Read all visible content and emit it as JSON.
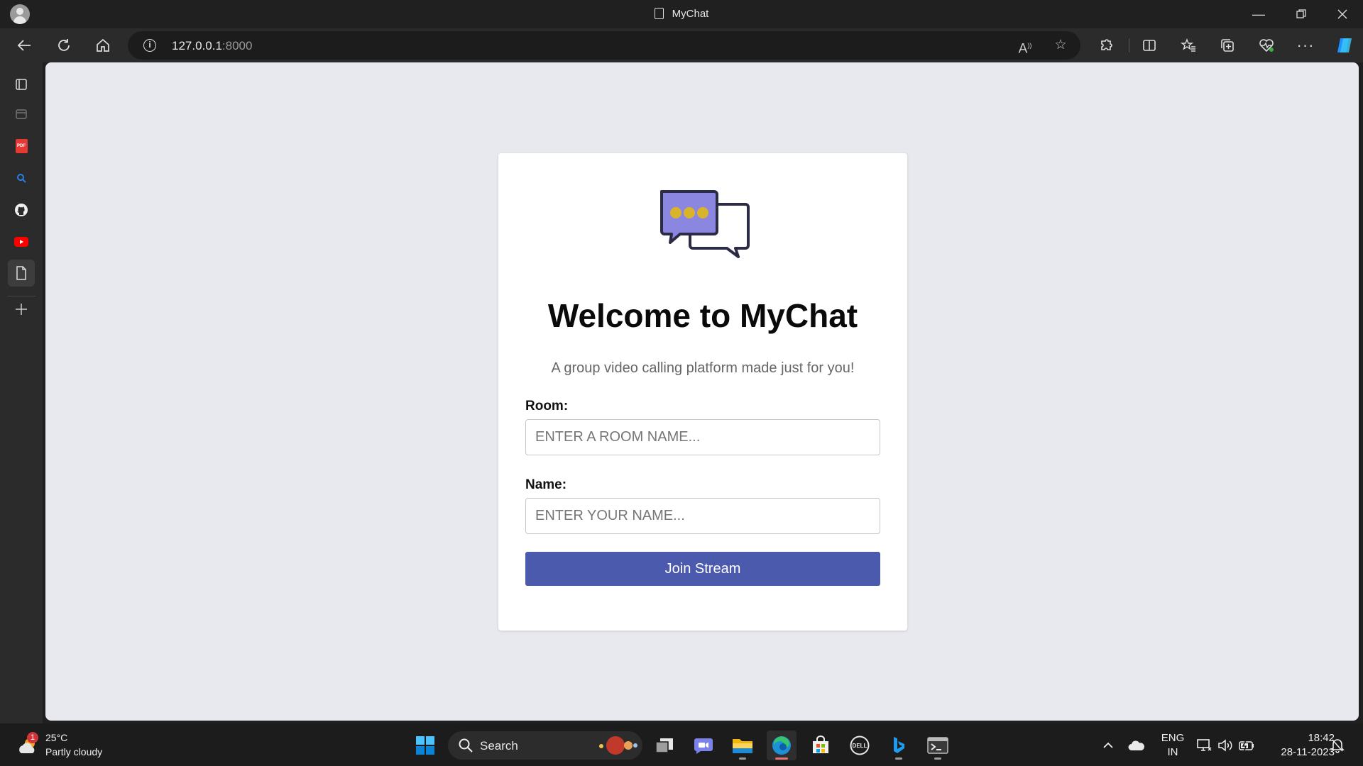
{
  "window": {
    "title": "MyChat"
  },
  "browser": {
    "url_host": "127.0.0.1",
    "url_port": ":8000"
  },
  "page": {
    "heading": "Welcome to MyChat",
    "tagline": "A group video calling platform made just for you!",
    "room_label": "Room:",
    "room_placeholder": "ENTER A ROOM NAME...",
    "name_label": "Name:",
    "name_placeholder": "ENTER YOUR NAME...",
    "join_label": "Join Stream"
  },
  "colors": {
    "accent_button": "#4c5aae",
    "logo_bubble": "#8b87e0",
    "logo_dots": "#d9b42a",
    "page_bg": "#e8e9ee"
  },
  "taskbar": {
    "weather_temp": "25°C",
    "weather_desc": "Partly cloudy",
    "weather_badge": "1",
    "search_label": "Search",
    "lang_top": "ENG",
    "lang_bottom": "IN",
    "time": "18:42",
    "date": "28-11-2023"
  }
}
